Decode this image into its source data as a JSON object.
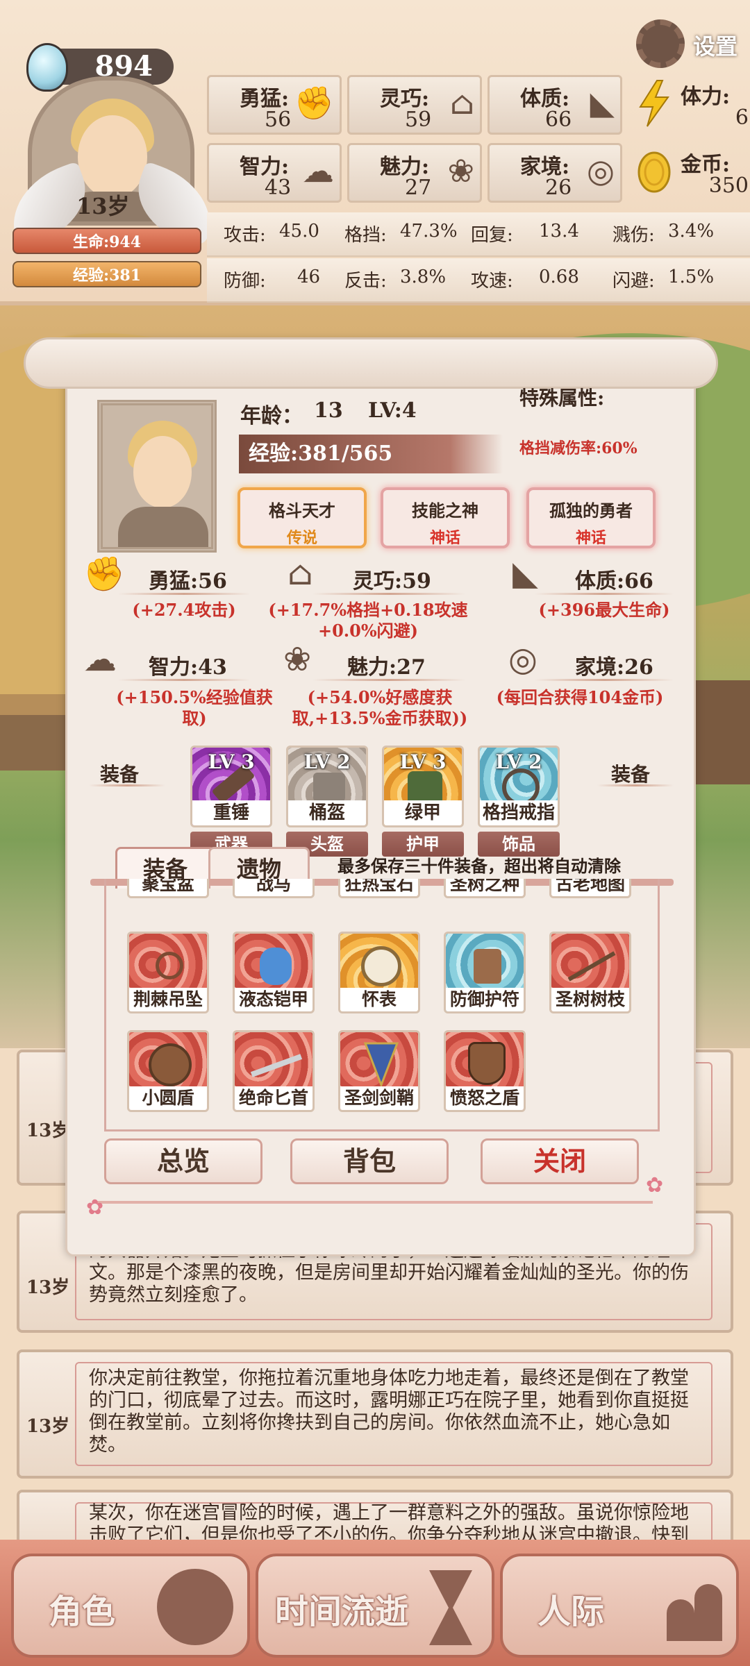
{
  "header": {
    "soul_points": "894",
    "age": "13岁",
    "hp": "生命:944",
    "exp": "经验:381",
    "settings_label": "设置"
  },
  "stats": [
    {
      "name": "勇猛:",
      "value": "56",
      "icon": "fist-icon"
    },
    {
      "name": "灵巧:",
      "value": "59",
      "icon": "cloak-icon"
    },
    {
      "name": "体质:",
      "value": "66",
      "icon": "flexed-arm-icon"
    },
    {
      "name": "智力:",
      "value": "43",
      "icon": "brain-icon"
    },
    {
      "name": "魅力:",
      "value": "27",
      "icon": "lotus-icon"
    },
    {
      "name": "家境:",
      "value": "26",
      "icon": "coin-hand-icon"
    }
  ],
  "resources": {
    "stamina": {
      "name": "体力:",
      "value": "6",
      "icon": "lightning-icon"
    },
    "gold": {
      "name": "金币:",
      "value": "350",
      "icon": "gold-coin-icon"
    }
  },
  "substats": [
    {
      "label": "攻击:",
      "value": "45.0"
    },
    {
      "label": "格挡:",
      "value": "47.3%"
    },
    {
      "label": "回复:",
      "value": "13.4"
    },
    {
      "label": "溅伤:",
      "value": "3.4%"
    },
    {
      "label": "防御:",
      "value": "46"
    },
    {
      "label": "反击:",
      "value": "3.8%"
    },
    {
      "label": "攻速:",
      "value": "0.68"
    },
    {
      "label": "闪避:",
      "value": "1.5%"
    }
  ],
  "dialog": {
    "age_label": "年龄：",
    "age_value": "13",
    "level": "LV:4",
    "exp": "经验:381/565",
    "special_title": "特殊属性:",
    "special_value": "格挡减伤率:60%",
    "traits": [
      {
        "name": "格斗天才",
        "rarity": "传说",
        "rarity_color": "#e0891a"
      },
      {
        "name": "技能之神",
        "rarity": "神话",
        "rarity_color": "#d8332a"
      },
      {
        "name": "孤独的勇者",
        "rarity": "神话",
        "rarity_color": "#d8332a"
      }
    ],
    "attributes": [
      {
        "name": "勇猛:56",
        "bonus": "(+27.4攻击)",
        "icon": "fist-icon"
      },
      {
        "name": "灵巧:59",
        "bonus": "(+17.7%格挡+0.18攻速+0.0%闪避)",
        "icon": "cloak-icon"
      },
      {
        "name": "体质:66",
        "bonus": "(+396最大生命)",
        "icon": "flexed-arm-icon"
      },
      {
        "name": "智力:43",
        "bonus": "(+150.5%经验值获取)",
        "icon": "brain-icon"
      },
      {
        "name": "魅力:27",
        "bonus": "(+54.0%好感度获取,+13.5%金币获取))",
        "icon": "lotus-icon"
      },
      {
        "name": "家境:26",
        "bonus": "(每回合获得104金币)",
        "icon": "coin-hand-icon"
      }
    ],
    "equip_side_label": "装备",
    "equipment": [
      {
        "level": "LV 3",
        "name": "重锤",
        "slot": "武器",
        "bg": "bg-purple",
        "icon": "hammer-icon"
      },
      {
        "level": "LV 2",
        "name": "桶盔",
        "slot": "头盔",
        "bg": "bg-gray",
        "icon": "bucket-helm-icon"
      },
      {
        "level": "LV 3",
        "name": "绿甲",
        "slot": "护甲",
        "bg": "bg-orange",
        "icon": "green-armor-icon"
      },
      {
        "level": "LV 2",
        "name": "格挡戒指",
        "slot": "饰品",
        "bg": "bg-blue",
        "icon": "ring-icon"
      }
    ],
    "tabs": [
      "装备",
      "遗物"
    ],
    "inventory_note": "最多保存三十件装备，超出将自动清除",
    "partial_row": [
      "聚宝盆",
      "战马",
      "狂热宝石",
      "圣树之种",
      "古老地图"
    ],
    "items": [
      {
        "name": "荆棘吊坠",
        "bg": "bg-red",
        "icon": "pendant-icon"
      },
      {
        "name": "液态铠甲",
        "bg": "bg-red",
        "icon": "liquid-armor-icon"
      },
      {
        "name": "怀表",
        "bg": "bg-orange",
        "icon": "pocket-watch-icon"
      },
      {
        "name": "防御护符",
        "bg": "bg-blue",
        "icon": "amulet-icon"
      },
      {
        "name": "圣树树枝",
        "bg": "bg-red",
        "icon": "branch-icon"
      },
      {
        "name": "小圆盾",
        "bg": "bg-red",
        "icon": "buckler-icon"
      },
      {
        "name": "绝命匕首",
        "bg": "bg-red",
        "icon": "dagger-icon"
      },
      {
        "name": "圣剑剑鞘",
        "bg": "bg-red",
        "icon": "scabbard-icon"
      },
      {
        "name": "愤怒之盾",
        "bg": "bg-red",
        "icon": "rage-shield-icon"
      }
    ],
    "buttons": {
      "overview": "总览",
      "bag": "背包",
      "close": "关闭"
    }
  },
  "log": [
    {
      "age": "13岁",
      "text": ""
    },
    {
      "age": "13岁",
      "text": "的兵器开始。她立马抓住了你冰冷的手，一遍遍咏唱那几条记忆中的经文。那是个漆黑的夜晚，但是房间里却开始闪耀着金灿灿的圣光。你的伤势竟然立刻痊愈了。"
    },
    {
      "age": "13岁",
      "text": "你决定前往教堂，你拖拉着沉重地身体吃力地走着，最终还是倒在了教堂的门口，彻底晕了过去。而这时，露明娜正巧在院子里，她看到你直挺挺倒在教堂前。立刻将你搀扶到自己的房间。你依然血流不止，她心急如焚。"
    },
    {
      "age": "",
      "text": "某次，你在迷宫冒险的时候，遇上了一群意料之外的强敌。虽说你惊险地击败了它们，但是你也受了不小的伤。你争分夺秒地从迷宫中撤退。快到"
    }
  ],
  "nav": [
    {
      "label": "角色",
      "icon": "character-icon"
    },
    {
      "label": "时间流逝",
      "icon": "hourglass-icon"
    },
    {
      "label": "人际",
      "icon": "people-icon"
    }
  ]
}
